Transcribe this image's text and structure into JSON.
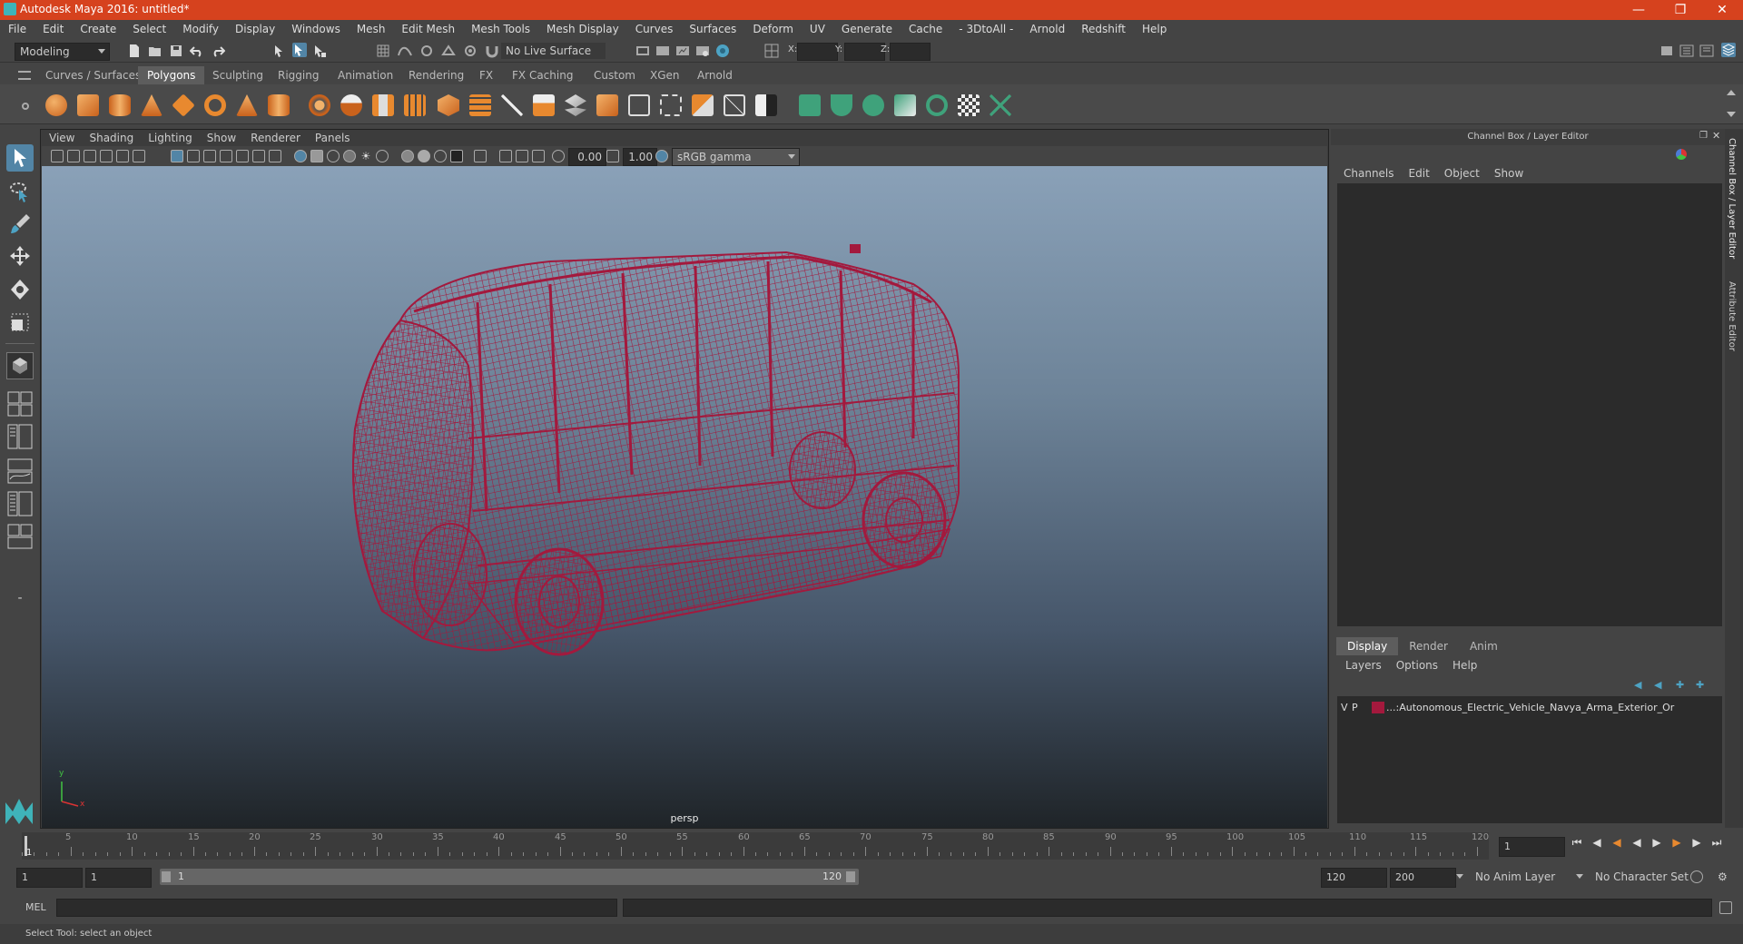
{
  "window": {
    "title": "Autodesk Maya 2016: untitled*"
  },
  "menubar": [
    "File",
    "Edit",
    "Create",
    "Select",
    "Modify",
    "Display",
    "Windows",
    "Mesh",
    "Edit Mesh",
    "Mesh Tools",
    "Mesh Display",
    "Curves",
    "Surfaces",
    "Deform",
    "UV",
    "Generate",
    "Cache",
    "- 3DtoAll -",
    "Arnold",
    "Redshift",
    "Help"
  ],
  "statusline": {
    "mode": "Modeling",
    "live_surface": "No Live Surface",
    "x_label": "X:",
    "y_label": "Y:",
    "z_label": "Z:"
  },
  "shelf_tabs": [
    "Curves / Surfaces",
    "Polygons",
    "Sculpting",
    "Rigging",
    "Animation",
    "Rendering",
    "FX",
    "FX Caching",
    "Custom",
    "XGen",
    "Arnold"
  ],
  "shelf_active": "Polygons",
  "panel_menu": [
    "View",
    "Shading",
    "Lighting",
    "Show",
    "Renderer",
    "Panels"
  ],
  "viewport_toolbar": {
    "exposure": "0.00",
    "gamma": "1.00",
    "colorspace": "sRGB gamma"
  },
  "viewport": {
    "camera": "persp",
    "axis_y": "y",
    "axis_x": "x"
  },
  "channel_box": {
    "header": "Channel Box / Layer Editor",
    "menu": [
      "Channels",
      "Edit",
      "Object",
      "Show"
    ],
    "layer_tabs": [
      "Display",
      "Render",
      "Anim"
    ],
    "layer_active": "Display",
    "layer_menu": [
      "Layers",
      "Options",
      "Help"
    ],
    "layer_row": {
      "v": "V",
      "p": "P",
      "name": "...:Autonomous_Electric_Vehicle_Navya_Arma_Exterior_Or",
      "color": "#a3193d"
    }
  },
  "side_tabs": [
    "Channel Box / Layer Editor",
    "Attribute Editor"
  ],
  "timeline": {
    "labels": [
      "5",
      "10",
      "15",
      "20",
      "25",
      "30",
      "35",
      "40",
      "45",
      "50",
      "55",
      "60",
      "65",
      "70",
      "75",
      "80",
      "85",
      "90",
      "95",
      "100",
      "105",
      "110",
      "115",
      "120"
    ],
    "current_frame_marker": "1",
    "current_frame": "1"
  },
  "range": {
    "start": "1",
    "anim_start": "1",
    "range_start_label": "1",
    "range_end_label": "120",
    "end": "120",
    "anim_end": "200",
    "anim_layer": "No Anim Layer",
    "character_set": "No Character Set"
  },
  "cmdline": {
    "label": "MEL"
  },
  "help_line": "Select Tool: select an object",
  "colors": {
    "wire": "#a3193d",
    "title": "#d6421e"
  }
}
